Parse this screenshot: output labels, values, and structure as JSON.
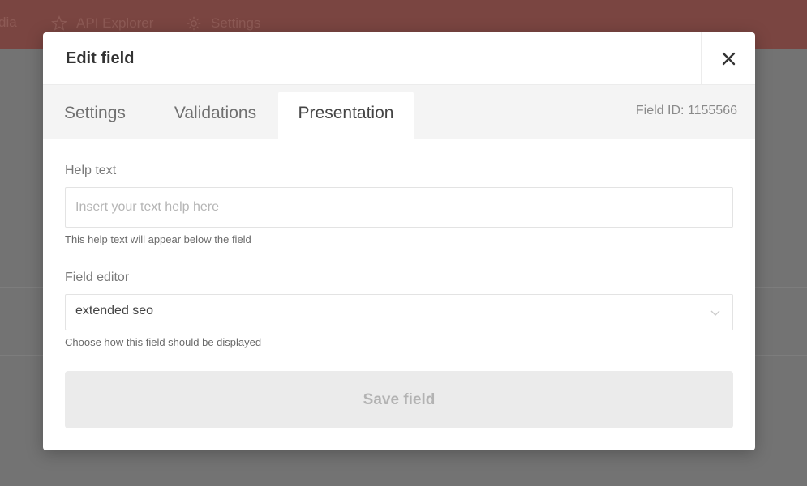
{
  "background": {
    "nav": {
      "media_label": "dia",
      "api_label": "API Explorer",
      "settings_label": "Settings"
    }
  },
  "modal": {
    "title": "Edit field",
    "close_icon": "close-icon",
    "tabs": [
      {
        "label": "Settings",
        "active": false
      },
      {
        "label": "Validations",
        "active": false
      },
      {
        "label": "Presentation",
        "active": true
      }
    ],
    "field_id": "Field ID: 1155566",
    "help_text": {
      "label": "Help text",
      "placeholder": "Insert your text help here",
      "value": "",
      "hint": "This help text will appear below the field"
    },
    "field_editor": {
      "label": "Field editor",
      "selected": "extended seo",
      "hint": "Choose how this field should be displayed"
    },
    "save_label": "Save field"
  },
  "colors": {
    "overlay": "#6f6f6f",
    "topbar": "#7a4541",
    "modal_bg": "#ffffff",
    "tab_bar_bg": "#f4f4f4",
    "save_button_bg": "#ebebeb"
  }
}
